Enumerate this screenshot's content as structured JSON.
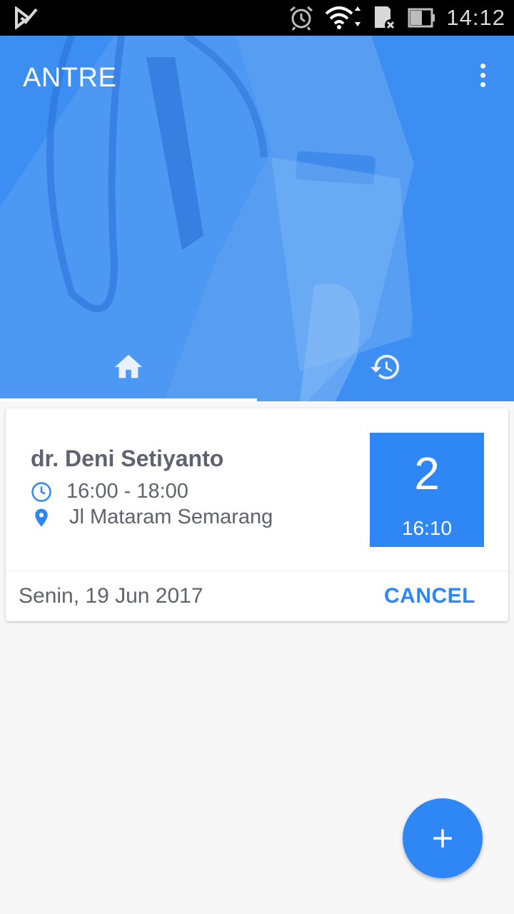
{
  "status_bar": {
    "time": "14:12",
    "icons": [
      "play-check-icon",
      "alarm-icon",
      "wifi-icon",
      "sd-card-icon",
      "battery-icon"
    ]
  },
  "app_bar": {
    "title": "ANTRE",
    "menu_icon": "more-vert-icon"
  },
  "tabs": [
    {
      "icon": "home-icon",
      "active": true
    },
    {
      "icon": "history-icon",
      "active": false
    }
  ],
  "appointment": {
    "doctor": "dr. Deni Setiyanto",
    "time_range": "16:00 - 18:00",
    "location": "Jl Mataram Semarang",
    "queue_number": "2",
    "queue_time": "16:10",
    "date": "Senin, 19 Jun 2017",
    "cancel_label": "CANCEL"
  },
  "fab": {
    "icon": "add-icon"
  },
  "colors": {
    "primary": "#3c8ef2",
    "accent": "#2f86f5",
    "text": "#5f6270",
    "background": "#f7f7f7"
  }
}
